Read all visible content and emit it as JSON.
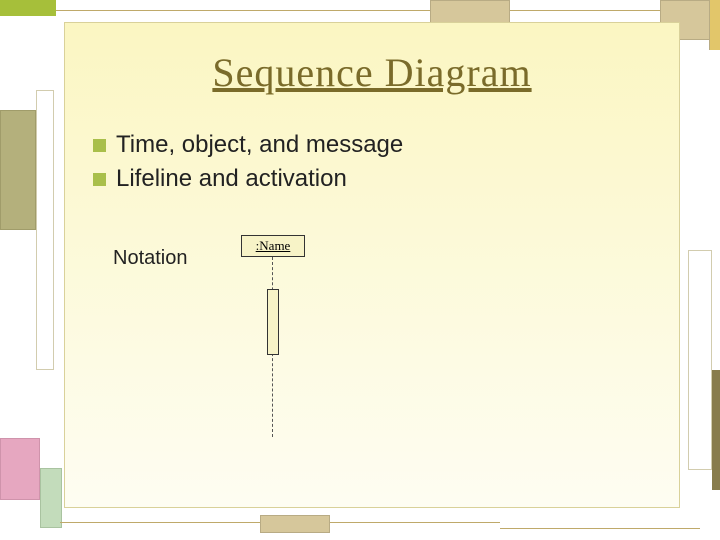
{
  "slide": {
    "title": "Sequence Diagram",
    "bullets": [
      "Time, object, and message",
      "Lifeline and activation"
    ],
    "notation_label": "Notation",
    "uml": {
      "object_label": ":Name"
    }
  }
}
